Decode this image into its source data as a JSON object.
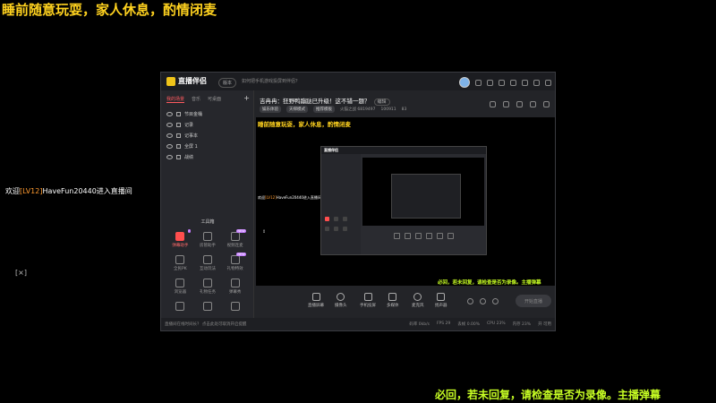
{
  "stream": {
    "title": "睡前随意玩耍，家人休息，酌情闭麦",
    "welcome_prefix": "欢迎",
    "welcome_level": "[LV12]",
    "welcome_suffix": "HaveFun20440进入直播间",
    "side_glyph": "[×]",
    "marquee": "必回，若未回复，请检查是否为录像。主播弹幕"
  },
  "window": {
    "logo_text": "直播伴侣",
    "version_label": "版本",
    "notice_text": "如何把手机游戏投屏到伴侣？",
    "scene_tabs": [
      {
        "label": "我的场景",
        "active": true
      },
      {
        "label": "音乐"
      },
      {
        "label": "可桌面"
      }
    ],
    "add_scene": "+",
    "scenes": [
      {
        "label": "节目金桶"
      },
      {
        "label": "记录"
      },
      {
        "label": "记事本"
      },
      {
        "label": "全屏 1"
      },
      {
        "label": "战绩"
      }
    ],
    "tools_title": "工具箱",
    "tools": [
      {
        "label": "弹幕助手",
        "icon": "danmaku-icon",
        "active": true,
        "badge": "·"
      },
      {
        "label": "房管助手",
        "icon": "user-icon"
      },
      {
        "label": "视频连麦",
        "icon": "video-icon",
        "badge": "NEW"
      },
      {
        "label": "全民PK",
        "icon": "pk-icon"
      },
      {
        "label": "互动玩法",
        "icon": "game-icon"
      },
      {
        "label": "礼物特效",
        "icon": "gift-icon",
        "badge": "NEW"
      },
      {
        "label": "浏览器",
        "icon": "browser-icon"
      },
      {
        "label": "礼物任务",
        "icon": "task-icon"
      },
      {
        "label": "弹幕秀",
        "icon": "show-icon"
      },
      {
        "label": "",
        "icon": "record-icon"
      },
      {
        "label": "",
        "icon": "download-icon"
      },
      {
        "label": "",
        "icon": "home-icon"
      }
    ],
    "room": {
      "title": "吉冉冉：狂野鸭蹦跶已升级！这不错一题？",
      "edit": "编辑",
      "chips": [
        "娱乐体验",
        "天梯模式",
        "推荐模板"
      ],
      "room_id": "火猫之战 6819497",
      "likes": "100911",
      "viewers": "83"
    },
    "preview": {
      "title": "睡前随意玩耍，家人休息，酌情闭麦",
      "welcome_prefix": "欢迎",
      "welcome_level": "[LV12]",
      "welcome_suffix": "HaveFun20440进入直播间",
      "arrow": "⇕",
      "marquee": "必回，若未回复，请检查是否为录像。主播弹幕"
    },
    "nested": {
      "logo_text": "直播伴侣"
    },
    "controls": [
      {
        "label": "直播屏幕",
        "icon": "screen-share-icon"
      },
      {
        "label": "摄像头",
        "icon": "camera-icon"
      },
      {
        "label": "手机投屏",
        "icon": "phone-cast-icon"
      },
      {
        "label": "多媒体",
        "icon": "media-icon"
      },
      {
        "label": "麦克风",
        "icon": "microphone-icon"
      },
      {
        "label": "扬声器",
        "icon": "speaker-icon"
      }
    ],
    "go_live_label": "开始直播",
    "status": {
      "message": "直播间在线时间长？ 点击此处可取消开启提醒",
      "stats": [
        "码率 0kb/s",
        "FPS 29",
        "丢帧 0.00%",
        "CPU 23%",
        "内存 23%",
        "开 可用"
      ]
    }
  }
}
